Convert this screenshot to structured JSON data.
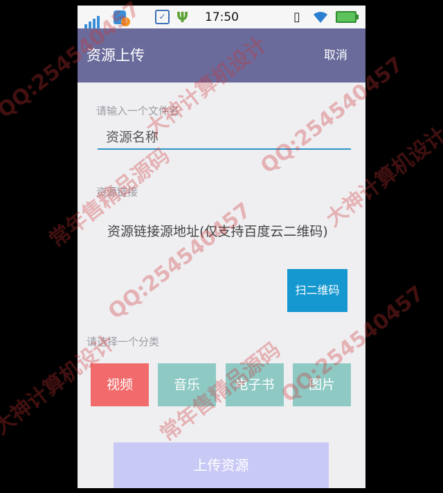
{
  "status_bar": {
    "notification_count": "3",
    "time": "17:50",
    "icons": [
      "signal-icon",
      "bag-icon",
      "check-icon",
      "usb-icon",
      "no-sim-icon",
      "wifi-icon",
      "battery-icon"
    ]
  },
  "header": {
    "title": "资源上传",
    "cancel_label": "取消",
    "color": "#6a6b9b"
  },
  "form": {
    "name_label": "请输入一个文件名",
    "name_value": "资源名称",
    "link_label": "资源链接",
    "link_value": "资源链接源地址(仅支持百度云二维码)",
    "scan_label": "扫二维码",
    "category_label": "请选择一个分类",
    "categories": [
      {
        "label": "视频",
        "color": "#f26b6c",
        "selected": true
      },
      {
        "label": "音乐",
        "color": "#8ec9c4",
        "selected": false
      },
      {
        "label": "电子书",
        "color": "#8ec9c4",
        "selected": false
      },
      {
        "label": "图片",
        "color": "#8ec9c4",
        "selected": false
      }
    ],
    "upload_label": "上传资源"
  },
  "watermarks": [
    "QQ:254540457",
    "常年售精品源码",
    "大神计算机设计"
  ]
}
